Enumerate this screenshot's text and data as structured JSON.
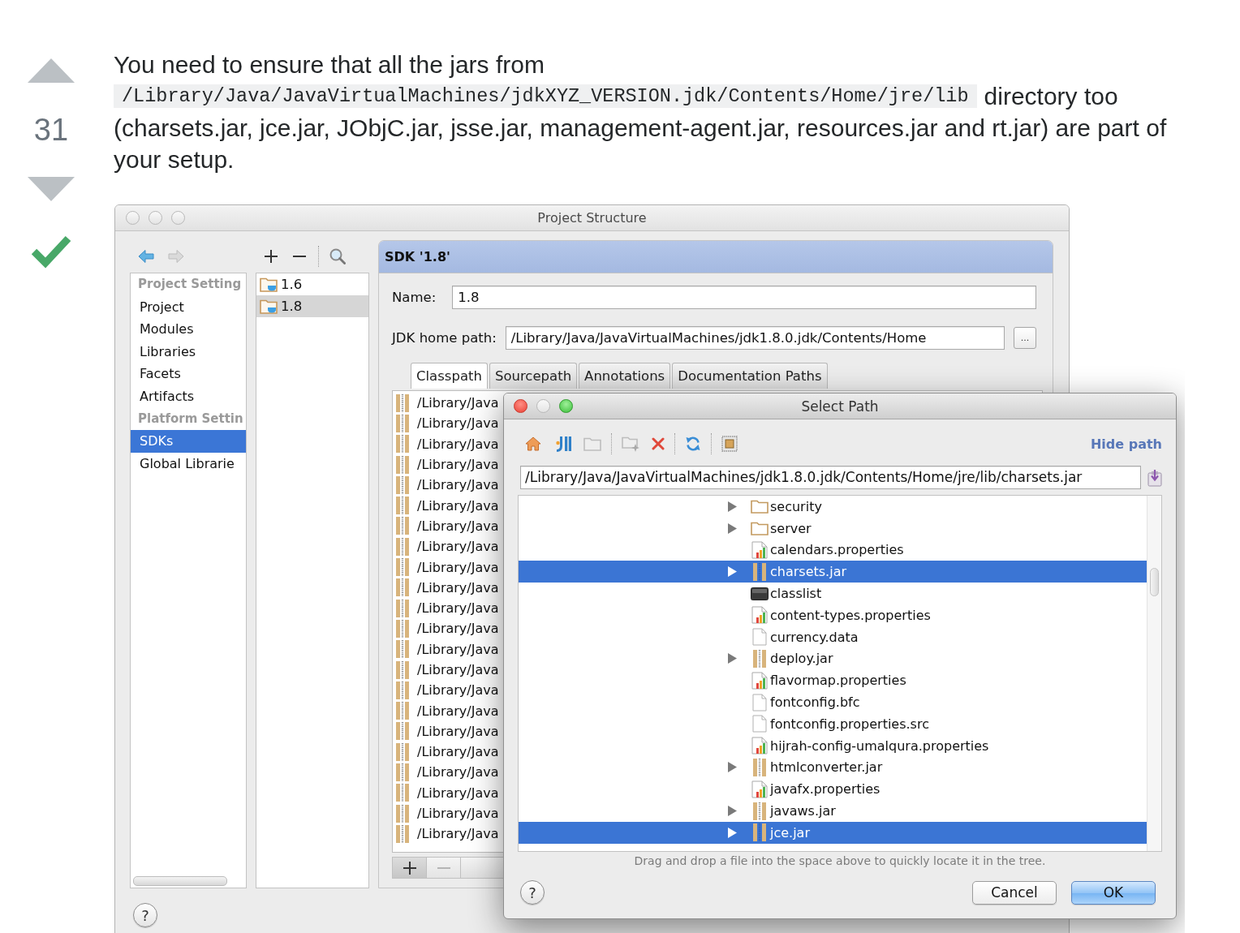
{
  "vote": {
    "upvoted": false,
    "score": "31",
    "downvoted": false,
    "accepted": true
  },
  "answer": {
    "intro": "You need to ensure that all the jars from",
    "code_path": "/Library/Java/JavaVirtualMachines/jdkXYZ_VERSION.jdk/Contents/Home/jre/lib",
    "after_code": "directory too",
    "details": "(charsets.jar, jce.jar, JObjC.jar, jsse.jar, management-agent.jar, resources.jar and rt.jar) are part of your setup."
  },
  "window": {
    "title": "Project Structure",
    "traffic_lights": [
      {
        "enabled": false
      },
      {
        "enabled": false
      },
      {
        "enabled": false
      }
    ],
    "nav_toolbar": [
      [
        {
          "kind": "back",
          "disabled": false
        },
        {
          "kind": "forward",
          "disabled": true
        }
      ]
    ],
    "list_toolbar": [
      [
        {
          "kind": "add",
          "disabled": false
        },
        {
          "kind": "remove",
          "disabled": false
        }
      ],
      [
        {
          "kind": "search",
          "disabled": false
        }
      ]
    ],
    "sidebar": [
      {
        "kind": "header",
        "label": "Project Setting",
        "selected": false
      },
      {
        "kind": "item",
        "label": "Project",
        "selected": false
      },
      {
        "kind": "item",
        "label": "Modules",
        "selected": false
      },
      {
        "kind": "item",
        "label": "Libraries",
        "selected": false
      },
      {
        "kind": "item",
        "label": "Facets",
        "selected": false
      },
      {
        "kind": "item",
        "label": "Artifacts",
        "selected": false
      },
      {
        "kind": "header",
        "label": "Platform Settin",
        "selected": false
      },
      {
        "kind": "item",
        "label": "SDKs",
        "selected": true
      },
      {
        "kind": "item",
        "label": "Global Librarie",
        "selected": false
      }
    ],
    "sdk_list": [
      {
        "label": "1.6",
        "selected": false
      },
      {
        "label": "1.8",
        "selected": true
      }
    ],
    "sdk_panel": {
      "title": "SDK '1.8'",
      "name_label": "Name:",
      "name_value": "1.8",
      "home_label": "JDK home path:",
      "home_value": "/Library/Java/JavaVirtualMachines/jdk1.8.0.jdk/Contents/Home",
      "browse_button": "...",
      "tabs": [
        {
          "label": "Classpath",
          "selected": true
        },
        {
          "label": "Sourcepath",
          "selected": false
        },
        {
          "label": "Annotations",
          "selected": false
        },
        {
          "label": "Documentation Paths",
          "selected": false
        }
      ],
      "classpath_rows": [
        "/Library/Java",
        "/Library/Java",
        "/Library/Java",
        "/Library/Java",
        "/Library/Java",
        "/Library/Java",
        "/Library/Java",
        "/Library/Java",
        "/Library/Java",
        "/Library/Java",
        "/Library/Java",
        "/Library/Java",
        "/Library/Java",
        "/Library/Java",
        "/Library/Java",
        "/Library/Java",
        "/Library/Java",
        "/Library/Java",
        "/Library/Java",
        "/Library/Java",
        "/Library/Java",
        "/Library/Java"
      ],
      "list_buttons": [
        {
          "kind": "add",
          "disabled": false
        },
        {
          "kind": "remove",
          "disabled": true
        }
      ]
    },
    "help_button": "?"
  },
  "dialog": {
    "title": "Select Path",
    "traffic_lights": [
      {
        "enabled": true
      },
      {
        "enabled": false
      },
      {
        "enabled": true
      }
    ],
    "toolbar": [
      [
        {
          "kind": "home",
          "disabled": false
        },
        {
          "kind": "module",
          "disabled": false
        },
        {
          "kind": "folder",
          "disabled": true
        }
      ],
      [
        {
          "kind": "new_folder",
          "disabled": true
        },
        {
          "kind": "delete",
          "disabled": false
        }
      ],
      [
        {
          "kind": "refresh",
          "disabled": false
        }
      ],
      [
        {
          "kind": "hidden",
          "disabled": false
        }
      ]
    ],
    "hide_path_link": "Hide path",
    "path_value": "/Library/Java/JavaVirtualMachines/jdk1.8.0.jdk/Contents/Home/jre/lib/charsets.jar",
    "tree": [
      {
        "label": "security",
        "kind": "folder",
        "expandable": true,
        "selected": false
      },
      {
        "label": "server",
        "kind": "folder",
        "expandable": true,
        "selected": false
      },
      {
        "label": "calendars.properties",
        "kind": "properties",
        "expandable": false,
        "selected": false
      },
      {
        "label": "charsets.jar",
        "kind": "jar",
        "expandable": true,
        "selected": true
      },
      {
        "label": "classlist",
        "kind": "binary",
        "expandable": false,
        "selected": false
      },
      {
        "label": "content-types.properties",
        "kind": "properties",
        "expandable": false,
        "selected": false
      },
      {
        "label": "currency.data",
        "kind": "file",
        "expandable": false,
        "selected": false
      },
      {
        "label": "deploy.jar",
        "kind": "jar",
        "expandable": true,
        "selected": false
      },
      {
        "label": "flavormap.properties",
        "kind": "properties",
        "expandable": false,
        "selected": false
      },
      {
        "label": "fontconfig.bfc",
        "kind": "file",
        "expandable": false,
        "selected": false
      },
      {
        "label": "fontconfig.properties.src",
        "kind": "file",
        "expandable": false,
        "selected": false
      },
      {
        "label": "hijrah-config-umalqura.properties",
        "kind": "properties",
        "expandable": false,
        "selected": false
      },
      {
        "label": "htmlconverter.jar",
        "kind": "jar",
        "expandable": true,
        "selected": false
      },
      {
        "label": "javafx.properties",
        "kind": "properties",
        "expandable": false,
        "selected": false
      },
      {
        "label": "javaws.jar",
        "kind": "jar",
        "expandable": true,
        "selected": false
      },
      {
        "label": "jce.jar",
        "kind": "jar",
        "expandable": true,
        "selected": true
      }
    ],
    "hint": "Drag and drop a file into the space above to quickly locate it in the tree.",
    "help_button": "?",
    "buttons": [
      {
        "label": "Cancel",
        "default": false
      },
      {
        "label": "OK",
        "default": true
      }
    ]
  }
}
